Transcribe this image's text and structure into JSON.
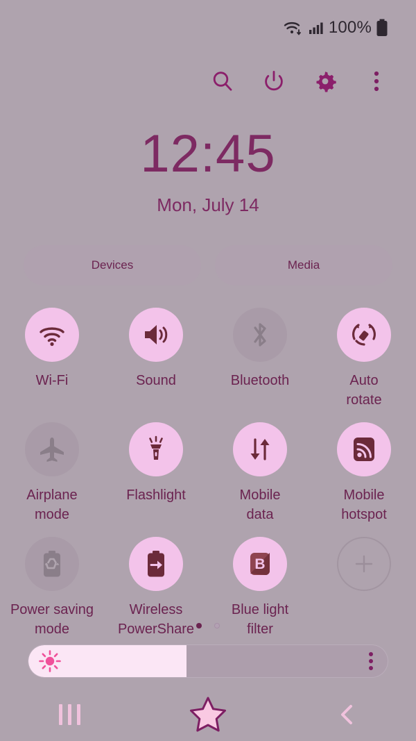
{
  "theme": {
    "background": "#afa3ae",
    "accent_active": "#f3c3ea",
    "accent_inactive": "#a99ba8",
    "icon_on": "#6b2a3a",
    "icon_off": "#8a7e89",
    "text": "#6b2350",
    "slider_fill": "#fbe6f5",
    "sun_icon": "#f0509a",
    "nav_icon": "#f0c2dd"
  },
  "status_bar": {
    "wifi_icon": "wifi-icon",
    "signal_icon": "cellular-signal-icon",
    "battery_percent": "100%",
    "battery_icon": "battery-full-icon"
  },
  "header": {
    "buttons": [
      {
        "name": "search-icon",
        "label": "Search"
      },
      {
        "name": "power-icon",
        "label": "Power"
      },
      {
        "name": "gear-icon",
        "label": "Settings"
      },
      {
        "name": "overflow-menu-icon",
        "label": "More options"
      }
    ]
  },
  "clock": {
    "time": "12:45",
    "date": "Mon, July 14"
  },
  "pills": [
    {
      "label": "Devices"
    },
    {
      "label": "Media"
    }
  ],
  "tiles": [
    {
      "label": "Wi-Fi",
      "icon": "wifi-icon",
      "state": "on"
    },
    {
      "label": "Sound",
      "icon": "sound-speaker-icon",
      "state": "on"
    },
    {
      "label": "Bluetooth",
      "icon": "bluetooth-icon",
      "state": "off"
    },
    {
      "label": "Auto\nrotate",
      "icon": "auto-rotate-icon",
      "state": "on"
    },
    {
      "label": "Airplane\nmode",
      "icon": "airplane-icon",
      "state": "off"
    },
    {
      "label": "Flashlight",
      "icon": "flashlight-icon",
      "state": "on"
    },
    {
      "label": "Mobile\ndata",
      "icon": "mobile-data-icon",
      "state": "on"
    },
    {
      "label": "Mobile\nhotspot",
      "icon": "mobile-hotspot-icon",
      "state": "on"
    },
    {
      "label": "Power saving\nmode",
      "icon": "power-saving-icon",
      "state": "off"
    },
    {
      "label": "Wireless\nPowerShare",
      "icon": "wireless-powershare-icon",
      "state": "on"
    },
    {
      "label": "Blue light\nfilter",
      "icon": "blue-light-filter-icon",
      "state": "on"
    },
    {
      "label": "",
      "icon": "add-plus-icon",
      "state": "add"
    }
  ],
  "page_dots": {
    "count": 2,
    "active_index": 0
  },
  "brightness": {
    "icon": "brightness-sun-icon",
    "value_percent": 44,
    "menu_icon": "overflow-menu-icon"
  },
  "nav_bar": [
    {
      "name": "recents-button",
      "icon": "recents-bars-icon"
    },
    {
      "name": "home-button",
      "icon": "star-home-icon"
    },
    {
      "name": "back-button",
      "icon": "chevron-left-icon"
    }
  ]
}
